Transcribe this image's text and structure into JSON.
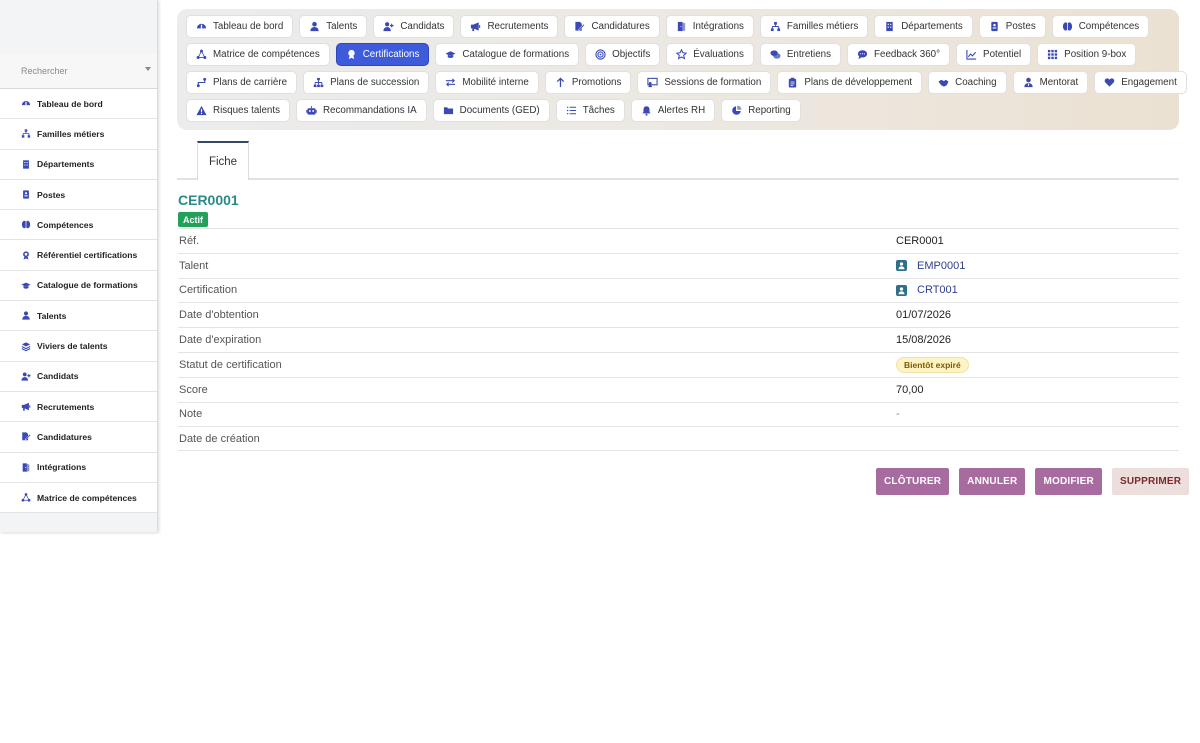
{
  "sidebar": {
    "search_placeholder": "Rechercher",
    "items": [
      {
        "label": "Tableau de bord",
        "icon": "dashboard-icon"
      },
      {
        "label": "Familles métiers",
        "icon": "hierarchy-icon"
      },
      {
        "label": "Départements",
        "icon": "building-icon"
      },
      {
        "label": "Postes",
        "icon": "badge-icon"
      },
      {
        "label": "Compétences",
        "icon": "brain-icon"
      },
      {
        "label": "Référentiel certifications",
        "icon": "certificate-icon"
      },
      {
        "label": "Catalogue de formations",
        "icon": "graduation-cap-icon"
      },
      {
        "label": "Talents",
        "icon": "user-icon"
      },
      {
        "label": "Viviers de talents",
        "icon": "layers-icon"
      },
      {
        "label": "Candidats",
        "icon": "user-plus-icon"
      },
      {
        "label": "Recrutements",
        "icon": "megaphone-icon"
      },
      {
        "label": "Candidatures",
        "icon": "file-signature-icon"
      },
      {
        "label": "Intégrations",
        "icon": "door-icon"
      },
      {
        "label": "Matrice de compétences",
        "icon": "network-icon"
      }
    ]
  },
  "topnav": {
    "rows": [
      [
        {
          "label": "Tableau de bord",
          "icon": "dashboard-icon"
        },
        {
          "label": "Talents",
          "icon": "user-icon"
        },
        {
          "label": "Candidats",
          "icon": "user-plus-icon"
        },
        {
          "label": "Recrutements",
          "icon": "megaphone-icon"
        },
        {
          "label": "Candidatures",
          "icon": "file-signature-icon"
        },
        {
          "label": "Intégrations",
          "icon": "door-icon"
        },
        {
          "label": "Familles métiers",
          "icon": "hierarchy-icon"
        },
        {
          "label": "Départements",
          "icon": "building-icon"
        },
        {
          "label": "Postes",
          "icon": "badge-icon"
        },
        {
          "label": "Compétences",
          "icon": "brain-icon"
        }
      ],
      [
        {
          "label": "Matrice de compétences",
          "icon": "network-icon"
        },
        {
          "label": "Certifications",
          "icon": "certificate-icon",
          "active": true
        },
        {
          "label": "Catalogue de formations",
          "icon": "graduation-cap-icon"
        },
        {
          "label": "Objectifs",
          "icon": "target-icon"
        },
        {
          "label": "Évaluations",
          "icon": "star-icon"
        },
        {
          "label": "Entretiens",
          "icon": "comments-icon"
        },
        {
          "label": "Feedback 360°",
          "icon": "comment-icon"
        },
        {
          "label": "Potentiel",
          "icon": "chart-line-icon"
        },
        {
          "label": "Position 9-box",
          "icon": "grid-icon"
        }
      ],
      [
        {
          "label": "Plans de carrière",
          "icon": "route-icon"
        },
        {
          "label": "Plans de succession",
          "icon": "sitemap-icon"
        },
        {
          "label": "Mobilité interne",
          "icon": "exchange-icon"
        },
        {
          "label": "Promotions",
          "icon": "arrow-up-icon"
        },
        {
          "label": "Sessions de formation",
          "icon": "chalkboard-icon"
        },
        {
          "label": "Plans de développement",
          "icon": "clipboard-icon"
        },
        {
          "label": "Coaching",
          "icon": "handshake-icon"
        },
        {
          "label": "Mentorat",
          "icon": "user-tie-icon"
        },
        {
          "label": "Engagement",
          "icon": "heart-icon"
        }
      ],
      [
        {
          "label": "Risques talents",
          "icon": "warning-icon"
        },
        {
          "label": "Recommandations IA",
          "icon": "robot-icon"
        },
        {
          "label": "Documents (GED)",
          "icon": "folder-icon"
        },
        {
          "label": "Tâches",
          "icon": "tasks-icon"
        },
        {
          "label": "Alertes RH",
          "icon": "bell-icon"
        },
        {
          "label": "Reporting",
          "icon": "pie-chart-icon"
        }
      ]
    ]
  },
  "tabs": {
    "fiche": "Fiche"
  },
  "record": {
    "title": "CER0001",
    "badge": "Actif",
    "fields": [
      {
        "label": "Réf.",
        "value": "CER0001",
        "kind": "text"
      },
      {
        "label": "Talent",
        "value": "EMP0001",
        "kind": "link"
      },
      {
        "label": "Certification",
        "value": "CRT001",
        "kind": "link"
      },
      {
        "label": "Date d'obtention",
        "value": "01/07/2026",
        "kind": "text"
      },
      {
        "label": "Date d'expiration",
        "value": "15/08/2026",
        "kind": "text"
      },
      {
        "label": "Statut de certification",
        "value": "Bientôt expiré",
        "kind": "badge"
      },
      {
        "label": "Score",
        "value": "70,00",
        "kind": "text"
      },
      {
        "label": "Note",
        "value": "-",
        "kind": "dash"
      },
      {
        "label": "Date de création",
        "value": "",
        "kind": "text"
      }
    ]
  },
  "actions": {
    "close": "CLÔTURER",
    "cancel": "ANNULER",
    "edit": "MODIFIER",
    "delete": "SUPPRIMER"
  },
  "colors": {
    "accent": "#3d5bdb",
    "title": "#2a8a8a",
    "active_badge": "#23a15a",
    "action": "#a76b9f",
    "icon": "#3a49b5"
  }
}
